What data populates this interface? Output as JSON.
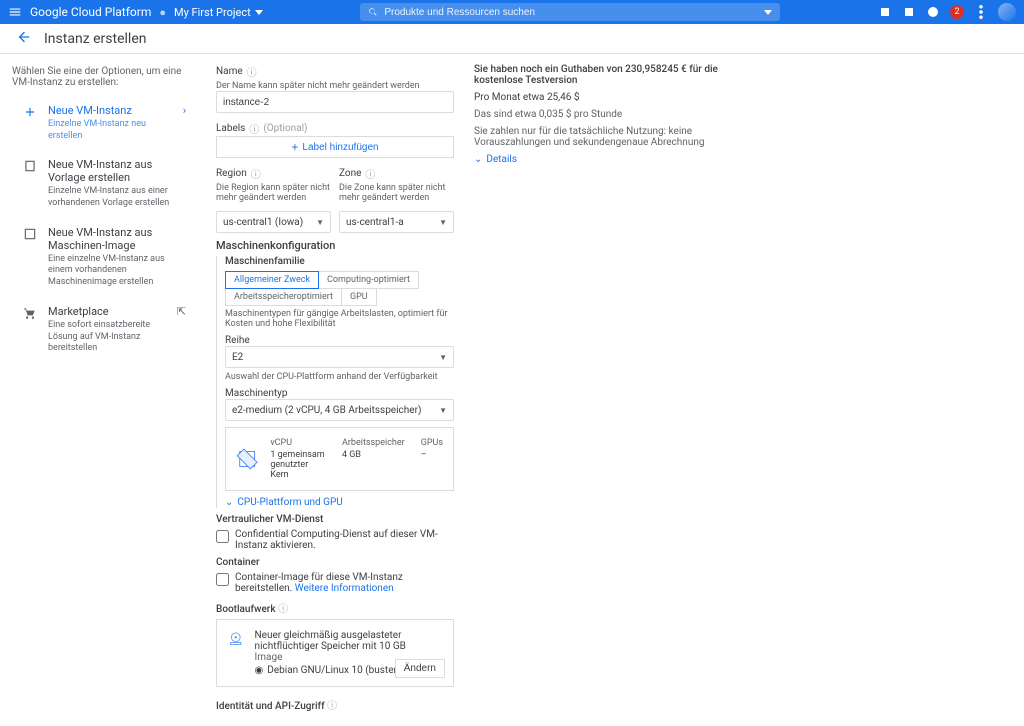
{
  "topbar": {
    "product": "Google Cloud Platform",
    "project": "My First Project",
    "search_placeholder": "Produkte und Ressourcen suchen",
    "notify_count": "2"
  },
  "page": {
    "title": "Instanz erstellen",
    "intro": "Wählen Sie eine der Optionen, um eine VM-Instanz zu erstellen:"
  },
  "sidebar": [
    {
      "title": "Neue VM-Instanz",
      "desc": "Einzelne VM-Instanz neu erstellen",
      "active": true
    },
    {
      "title": "Neue VM-Instanz aus Vorlage erstellen",
      "desc": "Einzelne VM-Instanz aus einer vorhandenen Vorlage erstellen"
    },
    {
      "title": "Neue VM-Instanz aus Maschinen-Image",
      "desc": "Eine einzelne VM-Instanz aus einem vorhandenen Maschinenimage erstellen"
    },
    {
      "title": "Marketplace",
      "desc": "Eine sofort einsatzbereite Lösung auf VM-Instanz bereitstellen"
    }
  ],
  "form": {
    "name_label": "Name",
    "name_hint": "Der Name kann später nicht mehr geändert werden",
    "name_value": "instance-2",
    "labels_label": "Labels",
    "labels_optional": "(Optional)",
    "labels_button": "Label hinzufügen",
    "region_label": "Region",
    "region_hint": "Die Region kann später nicht mehr geändert werden",
    "region_value": "us-central1 (Iowa)",
    "zone_label": "Zone",
    "zone_hint": "Die Zone kann später nicht mehr geändert werden",
    "zone_value": "us-central1-a",
    "machine_conf": "Maschinenkonfiguration",
    "machine_family_label": "Maschinenfamilie",
    "tabs": {
      "general": "Allgemeiner Zweck",
      "compute": "Computing-optimiert",
      "memory": "Arbeitsspeicheroptimiert",
      "gpu": "GPU"
    },
    "family_hint": "Maschinentypen für gängige Arbeitslasten, optimiert für Kosten und hohe Flexibilität",
    "series_label": "Reihe",
    "series_value": "E2",
    "series_hint": "Auswahl der CPU-Plattform anhand der Verfügbarkeit",
    "machinetype_label": "Maschinentyp",
    "machinetype_value": "e2-medium (2 vCPU, 4 GB Arbeitsspeicher)",
    "specs": {
      "vcpu_h": "vCPU",
      "mem_h": "Arbeitsspeicher",
      "gpu_h": "GPUs",
      "vcpu_v": "1 gemeinsam genutzter Kern",
      "mem_v": "4 GB",
      "gpu_v": "–"
    },
    "expander": "CPU-Plattform und GPU",
    "confidential_label": "Vertraulicher VM-Dienst",
    "confidential_text": "Confidential Computing-Dienst auf dieser VM-Instanz aktivieren.",
    "container_label": "Container",
    "container_text": "Container-Image für diese VM-Instanz bereitstellen.",
    "container_link": "Weitere Informationen",
    "boot_label": "Bootlaufwerk",
    "boot_line1": "Neuer gleichmäßig ausgelasteter nichtflüchtiger Speicher mit 10 GB",
    "boot_line2": "Image",
    "boot_os": "Debian GNU/Linux 10 (buster)",
    "boot_change": "Ändern",
    "identity_label": "Identität und API-Zugriff"
  },
  "info": {
    "headline": "Sie haben noch ein Guthaben von 230,958245 € für die kostenlose Testversion",
    "monthly": "Pro Monat etwa 25,46 $",
    "hourly": "Das sind etwa 0,035 $ pro Stunde",
    "note": "Sie zahlen nur für die tatsächliche Nutzung: keine Vorauszahlungen und sekundengenaue Abrechnung",
    "details": "Details"
  }
}
